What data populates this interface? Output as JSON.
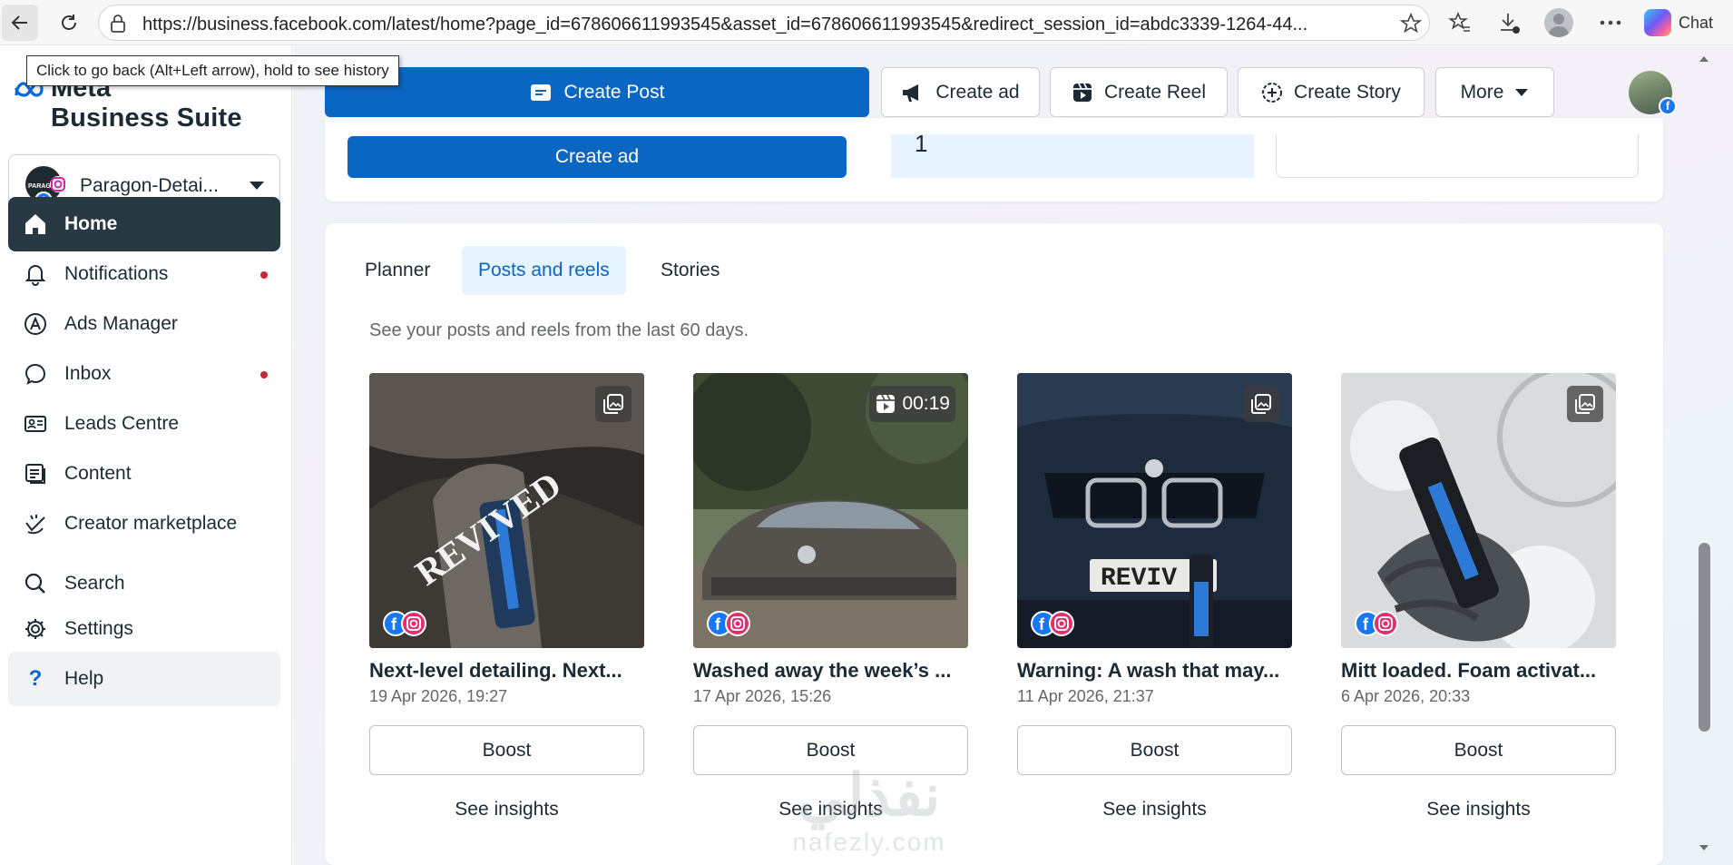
{
  "browser": {
    "url": "https://business.facebook.com/latest/home?page_id=678606611993545&asset_id=678606611993545&redirect_session_id=abdc3339-1264-44...",
    "chat_label": "Chat",
    "tooltip": "Click to go back (Alt+Left arrow), hold to see history"
  },
  "brand": {
    "line1": "Meta",
    "line2": "Business Suite"
  },
  "account": {
    "name": "Paragon-Detai..."
  },
  "sidebar": {
    "items": [
      {
        "label": "Home",
        "icon": "home-icon",
        "active": true
      },
      {
        "label": "Notifications",
        "icon": "bell-icon",
        "dot": true
      },
      {
        "label": "Ads Manager",
        "icon": "ads-manager-icon"
      },
      {
        "label": "Inbox",
        "icon": "chat-bubble-icon",
        "dot": true
      },
      {
        "label": "Leads Centre",
        "icon": "id-card-icon"
      },
      {
        "label": "Content",
        "icon": "content-icon"
      },
      {
        "label": "Creator marketplace",
        "icon": "creator-icon"
      },
      {
        "label": "Search",
        "icon": "search-icon"
      },
      {
        "label": "Settings",
        "icon": "gear-icon"
      },
      {
        "label": "Help",
        "icon": "question-icon"
      }
    ]
  },
  "top_actions": {
    "create_post": "Create Post",
    "create_ad": "Create ad",
    "create_reel": "Create Reel",
    "create_story": "Create Story",
    "more": "More"
  },
  "upper_card": {
    "create_ad_button": "Create ad",
    "panel_number": "1"
  },
  "posts": {
    "tabs": [
      "Planner",
      "Posts and reels",
      "Stories"
    ],
    "active_tab": "Posts and reels",
    "subtitle": "See your posts and reels from the last 60 days.",
    "items": [
      {
        "title": "Next-level detailing. Next...",
        "date": "19 Apr 2026, 19:27",
        "type": "photo",
        "overlay_text": "REVIVED",
        "boost": "Boost",
        "insights": "See insights"
      },
      {
        "title": "Washed away the week’s ...",
        "date": "17 Apr 2026, 15:26",
        "type": "reel",
        "duration": "00:19",
        "boost": "Boost",
        "insights": "See insights"
      },
      {
        "title": "Warning: A wash that may...",
        "date": "11 Apr 2026, 21:37",
        "type": "photo",
        "overlay_text": "REVIV",
        "boost": "Boost",
        "insights": "See insights"
      },
      {
        "title": "Mitt loaded. Foam activat...",
        "date": "6 Apr 2026, 20:33",
        "type": "photo",
        "boost": "Boost",
        "insights": "See insights"
      }
    ]
  },
  "watermark": {
    "arabic": "نفذلي",
    "latin": "nafezly.com"
  },
  "colors": {
    "primary": "#0a66c2",
    "active_nav": "#283943",
    "notification_dot": "#c5283d"
  }
}
